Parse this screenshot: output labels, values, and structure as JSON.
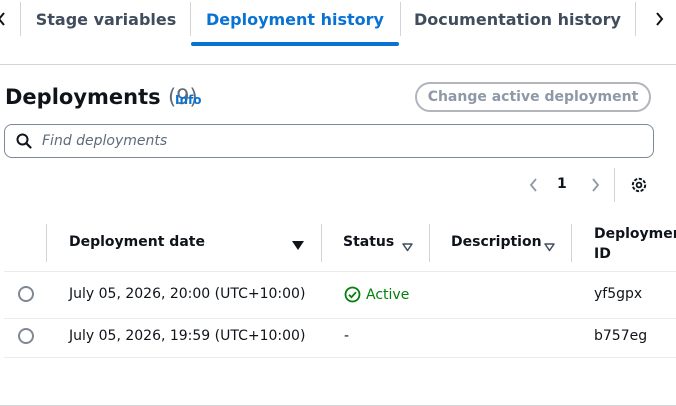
{
  "tabs": [
    {
      "label": "Stage variables",
      "active": false
    },
    {
      "label": "Deployment history",
      "active": true
    },
    {
      "label": "Documentation history",
      "active": false
    }
  ],
  "header": {
    "title": "Deployments",
    "count": "(9)",
    "info_label": "Info",
    "change_button": "Change active deployment"
  },
  "search": {
    "placeholder": "Find deployments"
  },
  "pagination": {
    "current_page": "1"
  },
  "table": {
    "columns": [
      "Deployment date",
      "Status",
      "Description",
      "Deployment ID"
    ],
    "rows": [
      {
        "date": "July 05, 2026, 20:00 (UTC+10:00)",
        "status": "Active",
        "description": "",
        "id": "yf5gpx"
      },
      {
        "date": "July 05, 2026, 19:59 (UTC+10:00)",
        "status": "-",
        "description": "",
        "id": "b757eg"
      }
    ]
  },
  "colors": {
    "accent": "#0972d3",
    "success": "#037f0c",
    "border": "#d1d5db",
    "disabled_text": "#8d99a8"
  },
  "icons": [
    "chevron-left-icon",
    "chevron-right-icon",
    "search-icon",
    "settings-gear-icon",
    "sort-desc-icon",
    "sort-caret-icon",
    "status-success-icon"
  ]
}
